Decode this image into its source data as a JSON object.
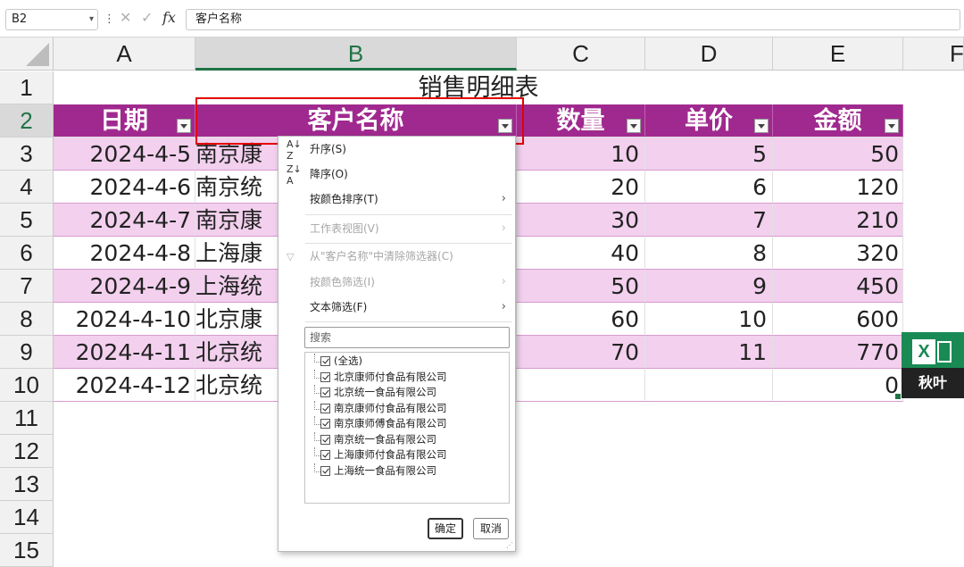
{
  "formula_bar": {
    "name_box": "B2",
    "separator": "⋮",
    "cancel_glyph": "✕",
    "confirm_glyph": "✓",
    "fx_label": "fx",
    "formula_value": "客户名称"
  },
  "columns": [
    "A",
    "B",
    "C",
    "D",
    "E",
    "F"
  ],
  "rows": [
    "1",
    "2",
    "3",
    "4",
    "5",
    "6",
    "7",
    "8",
    "9",
    "10",
    "11",
    "12",
    "13",
    "14",
    "15"
  ],
  "sheet": {
    "title": "销售明细表",
    "headers": {
      "date": "日期",
      "customer": "客户名称",
      "qty": "数量",
      "price": "单价",
      "amount": "金额"
    },
    "data": [
      {
        "date": "2024-4-5",
        "customer": "南京康",
        "qty": "10",
        "price": "5",
        "amount": "50"
      },
      {
        "date": "2024-4-6",
        "customer": "南京统",
        "qty": "20",
        "price": "6",
        "amount": "120"
      },
      {
        "date": "2024-4-7",
        "customer": "南京康",
        "qty": "30",
        "price": "7",
        "amount": "210"
      },
      {
        "date": "2024-4-8",
        "customer": "上海康",
        "qty": "40",
        "price": "8",
        "amount": "320"
      },
      {
        "date": "2024-4-9",
        "customer": "上海统",
        "qty": "50",
        "price": "9",
        "amount": "450"
      },
      {
        "date": "2024-4-10",
        "customer": "北京康",
        "qty": "60",
        "price": "10",
        "amount": "600"
      },
      {
        "date": "2024-4-11",
        "customer": "北京统",
        "qty": "70",
        "price": "11",
        "amount": "770"
      },
      {
        "date": "2024-4-12",
        "customer": "北京统",
        "qty": "",
        "price": "",
        "amount": "0"
      }
    ]
  },
  "filter_menu": {
    "sort_asc": "升序(S)",
    "sort_desc": "降序(O)",
    "sort_by_color": "按颜色排序(T)",
    "sheet_view": "工作表视图(V)",
    "clear_filter": "从\"客户名称\"中清除筛选器(C)",
    "filter_by_color": "按颜色筛选(I)",
    "text_filter": "文本筛选(F)",
    "search_placeholder": "搜索",
    "items": [
      "(全选)",
      "北京康师付食品有限公司",
      "北京统一食品有限公司",
      "南京康师付食品有限公司",
      "南京康师傅食品有限公司",
      "南京统一食品有限公司",
      "上海康师付食品有限公司",
      "上海统一食品有限公司"
    ],
    "ok_label": "确定",
    "cancel_label": "取消"
  },
  "logo": {
    "badge": "X",
    "label": "秋叶"
  },
  "colors": {
    "header_bg": "#a0298f",
    "band_bg": "#f2d0ee",
    "selection_green": "#217346",
    "highlight_red": "#e30000"
  }
}
